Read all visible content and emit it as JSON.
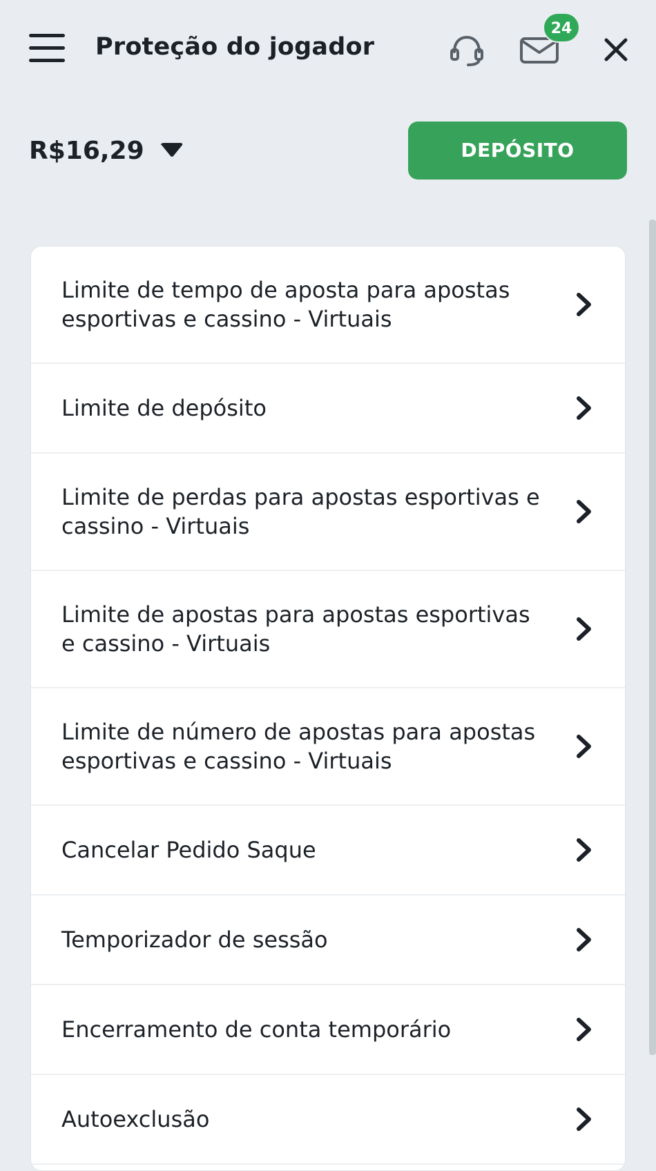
{
  "header": {
    "title": "Proteção do jogador",
    "icons": [
      "menu-icon",
      "headset-icon",
      "mail-icon",
      "close-icon"
    ],
    "mail_badge": "24"
  },
  "account": {
    "balance": "R$16,29",
    "deposit_label": "DEPÓSITO"
  },
  "colors": {
    "accent": "#37a35a",
    "badge": "#2fa957",
    "background": "#e9edf1",
    "text": "#1c2127"
  },
  "menu": {
    "items": [
      {
        "label": "Limite de tempo de aposta para apostas esportivas e cassino - Virtuais"
      },
      {
        "label": "Limite de depósito"
      },
      {
        "label": "Limite de perdas para apostas esportivas e cassino - Virtuais"
      },
      {
        "label": "Limite de apostas para apostas esportivas e cassino - Virtuais"
      },
      {
        "label": "Limite de número de apostas para apostas esportivas e cassino - Virtuais"
      },
      {
        "label": "Cancelar Pedido Saque"
      },
      {
        "label": "Temporizador de sessão"
      },
      {
        "label": "Encerramento de conta temporário"
      },
      {
        "label": "Autoexclusão"
      }
    ]
  }
}
